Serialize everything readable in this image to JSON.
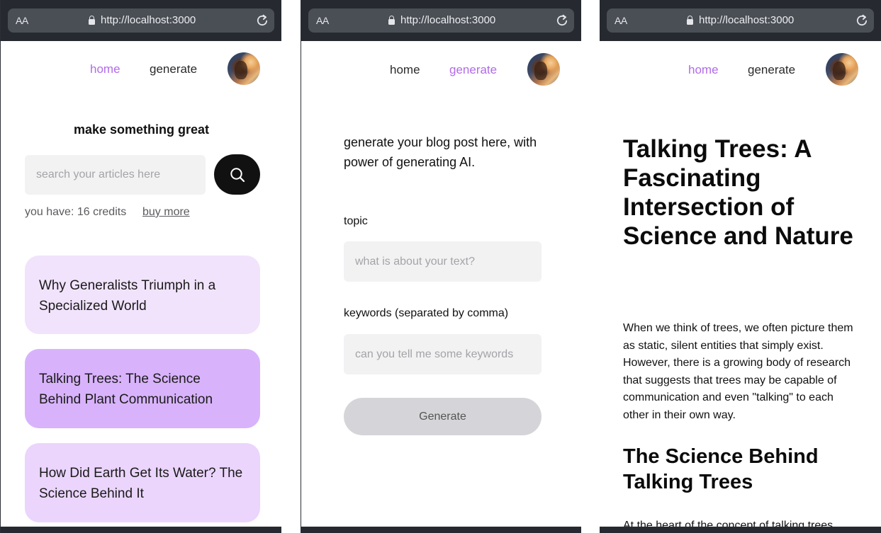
{
  "browser": {
    "text_size_label": "AA",
    "url": "http://localhost:3000"
  },
  "nav": {
    "home": "home",
    "generate": "generate"
  },
  "home_screen": {
    "title": "make something great",
    "search_placeholder": "search your articles here",
    "credits_text": "you have: 16 credits",
    "buy_more": "buy more",
    "articles": [
      "Why Generalists Triumph in a Specialized World",
      "Talking Trees: The Science Behind Plant Communication",
      "How Did Earth Get Its Water? The Science Behind It"
    ]
  },
  "generate_screen": {
    "intro": "generate your blog post here, with power of generating AI.",
    "topic_label": "topic",
    "topic_placeholder": "what is about your text?",
    "keywords_label": "keywords (separated by comma)",
    "keywords_placeholder": "can you tell me some keywords",
    "generate_button": "Generate"
  },
  "article_screen": {
    "title": "Talking Trees: A Fascinating Intersection of Science and Nature",
    "paragraph": "When we think of trees, we often picture them as static, silent entities that simply exist. However, there is a growing body of research that suggests that trees may be capable of communication and even \"talking\" to each other in their own way.",
    "heading": "The Science Behind Talking Trees",
    "cut_line": "At the heart of the concept of talking trees"
  },
  "colors": {
    "accent": "#b26be8",
    "browser_bar": "#262a30",
    "card_1": "#f1e3fc",
    "card_2": "#d8b3fb",
    "card_3": "#ebd5fc"
  },
  "icons": [
    "lock-icon",
    "reload-icon",
    "search-icon",
    "avatar"
  ]
}
